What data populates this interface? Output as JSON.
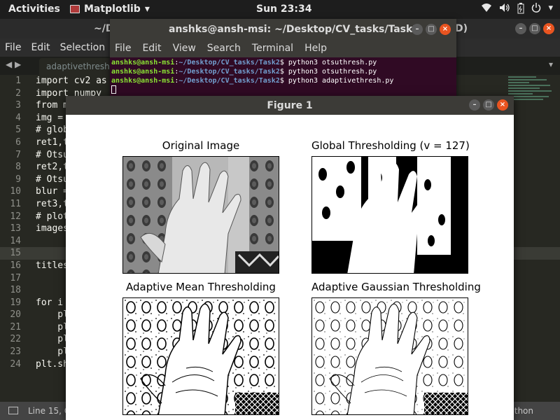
{
  "topbar": {
    "activities": "Activities",
    "app_name": "Matplotlib",
    "clock": "Sun 23:34",
    "tray_icons": [
      "wifi-icon",
      "volume-icon",
      "battery-icon",
      "power-icon"
    ]
  },
  "editor": {
    "title": "~/D",
    "title_suffix": "D)",
    "menu": [
      "File",
      "Edit",
      "Selection"
    ],
    "tab_label": "adaptivethresh.",
    "lines": [
      {
        "n": "1",
        "text": "import cv2 as"
      },
      {
        "n": "2",
        "text": "import numpy"
      },
      {
        "n": "3",
        "text": "from m"
      },
      {
        "n": "4",
        "text": "img ="
      },
      {
        "n": "5",
        "text": "# glob"
      },
      {
        "n": "6",
        "text": "ret1,t"
      },
      {
        "n": "7",
        "text": "# Otsu"
      },
      {
        "n": "8",
        "text": "ret2,t"
      },
      {
        "n": "9",
        "text": "# Otsu"
      },
      {
        "n": "10",
        "text": "blur ="
      },
      {
        "n": "11",
        "text": "ret3,t"
      },
      {
        "n": "12",
        "text": "# plot"
      },
      {
        "n": "13",
        "text": "images"
      },
      {
        "n": "14",
        "text": ""
      },
      {
        "n": "15",
        "text": ""
      },
      {
        "n": "16",
        "text": "titles"
      },
      {
        "n": "17",
        "text": ""
      },
      {
        "n": "18",
        "text": ""
      },
      {
        "n": "19",
        "text": "for i"
      },
      {
        "n": "20",
        "text": "    pl"
      },
      {
        "n": "21",
        "text": "    pl"
      },
      {
        "n": "22",
        "text": "    pl"
      },
      {
        "n": "23",
        "text": "    pl"
      },
      {
        "n": "24",
        "text": "plt.sh"
      }
    ],
    "status_position": "Line 15, C",
    "status_language": "thon"
  },
  "terminal": {
    "title": "anshks@ansh-msi: ~/Desktop/CV_tasks/Task2",
    "menu": [
      "File",
      "Edit",
      "View",
      "Search",
      "Terminal",
      "Help"
    ],
    "prompt_user": "anshks@ansh-msi",
    "prompt_path": "~/Desktop/CV_tasks/Task2",
    "commands": [
      "python3 otsuthresh.py",
      "python3 otsuthresh.py",
      "python3 adaptivethresh.py"
    ]
  },
  "figure": {
    "title": "Figure 1",
    "panels": [
      {
        "title": "Original Image",
        "kind": "gray"
      },
      {
        "title": "Global Thresholding (v = 127)",
        "kind": "global"
      },
      {
        "title": "Adaptive Mean Thresholding",
        "kind": "edges"
      },
      {
        "title": "Adaptive Gaussian Thresholding",
        "kind": "edges2"
      }
    ]
  }
}
